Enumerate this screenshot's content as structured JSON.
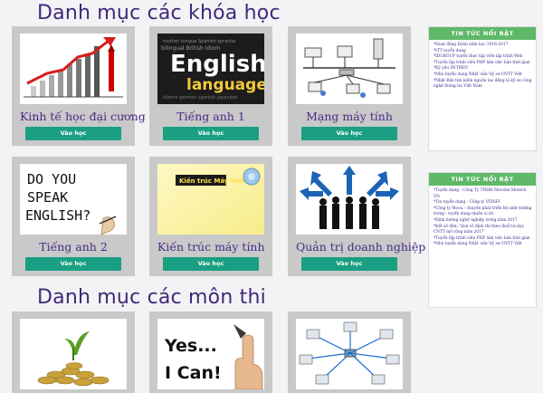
{
  "sections": {
    "courses_title": "Danh mục các khóa học",
    "exams_title": "Danh mục các môn thi"
  },
  "courses": [
    {
      "title": "Kinh tế học đại cương",
      "button": "Vào học",
      "icon": "rising-bar-chart-arrow-image"
    },
    {
      "title": "Tiếng anh 1",
      "button": "Vào học",
      "icon": "english-language-words-image"
    },
    {
      "title": "Mạng máy tính",
      "button": "Vào học",
      "icon": "computer-network-diagram-image"
    },
    {
      "title": "Tiếng anh 2",
      "button": "Vào học",
      "icon": "do-you-speak-english-image"
    },
    {
      "title": "Kiến trúc máy tính",
      "button": "Vào học",
      "icon": "computer-architecture-image"
    },
    {
      "title": "Quản trị doanh nghiệp",
      "button": "Vào học",
      "icon": "business-people-arrows-image"
    }
  ],
  "exams": [
    {
      "icon": "coins-plant-growth-image"
    },
    {
      "icon": "yes-i-can-image",
      "text_line1": "Yes...",
      "text_line2": "I Can!"
    },
    {
      "icon": "network-computers-image"
    }
  ],
  "news_boxes": [
    {
      "heading": "TIN TỨC NỔI BẬT",
      "items": [
        "*Hoạt động Đoàn năm học 2016-2017",
        "*ITT tuyển dụng",
        "*IDGROUP tuyển thực tập viên lập trình Web",
        "*Tuyển lập trình viên PHP làm việc bán thời gian",
        "*Kỳ yếu DVTMDT",
        "*Nhà tuyển dụng Nhật 'sắn' kỹ sư CNTT Việt",
        "*Nhật Bản tìm kiếm nguồn lao động là kỹ sư công nghệ thông tin Việt Nam"
      ]
    },
    {
      "heading": "TIN TỨC NỔI BẬT",
      "items": [
        "*Tuyển dụng - Công Ty TNHH Movobe Motech VN",
        "*Tin tuyển dụng - Công ty VIDSFI",
        "*Công ty Mova - chuyên phát triển hệ sinh trưởng trong - tuyển dụng nhiều vị trí",
        "*Định hướng nghề nghiệp trong năm 2017",
        "*Kết số đến: 'Quà vô định thì theo đuổi tư duy CNTT mở rộng năm 2017'",
        "*Tuyển lập trình viên PHP làm việc bán thời gian",
        "*Nhà tuyển dụng Nhật 'sắn' kỹ sư CNTT Việt"
      ]
    }
  ],
  "colors": {
    "title": "#3f2a7a",
    "button": "#1a9f83",
    "news_header": "#5fb868",
    "card_bg": "#c9c9c9"
  }
}
